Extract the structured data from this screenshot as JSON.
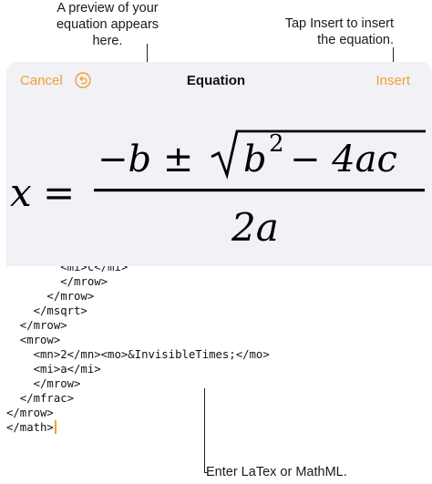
{
  "callouts": {
    "preview": "A preview of your equation appears here.",
    "insert": "Tap Insert to insert the equation.",
    "editor": "Enter LaTex or MathML."
  },
  "toolbar": {
    "cancel_label": "Cancel",
    "title": "Equation",
    "insert_label": "Insert",
    "undo_icon": "undo-icon"
  },
  "equation": {
    "lhs": "x",
    "equals": "=",
    "numerator_prefix": "−b ±",
    "radicand_base": "b",
    "radicand_exponent": "2",
    "radicand_rest": "− 4ac",
    "denominator": "2a"
  },
  "editor": {
    "lines": [
      "        <mi>c</mi>",
      "        </mrow>",
      "      </mrow>",
      "    </msqrt>",
      "  </mrow>",
      "  <mrow>",
      "    <mn>2</mn><mo>&InvisibleTimes;</mo>",
      "    <mi>a</mi>",
      "    </mrow>",
      "  </mfrac>",
      "</mrow>",
      "</math>"
    ]
  },
  "colors": {
    "accent": "#f0a032",
    "preview_background": "#f1f1f6",
    "page_background": "#ffffff"
  }
}
